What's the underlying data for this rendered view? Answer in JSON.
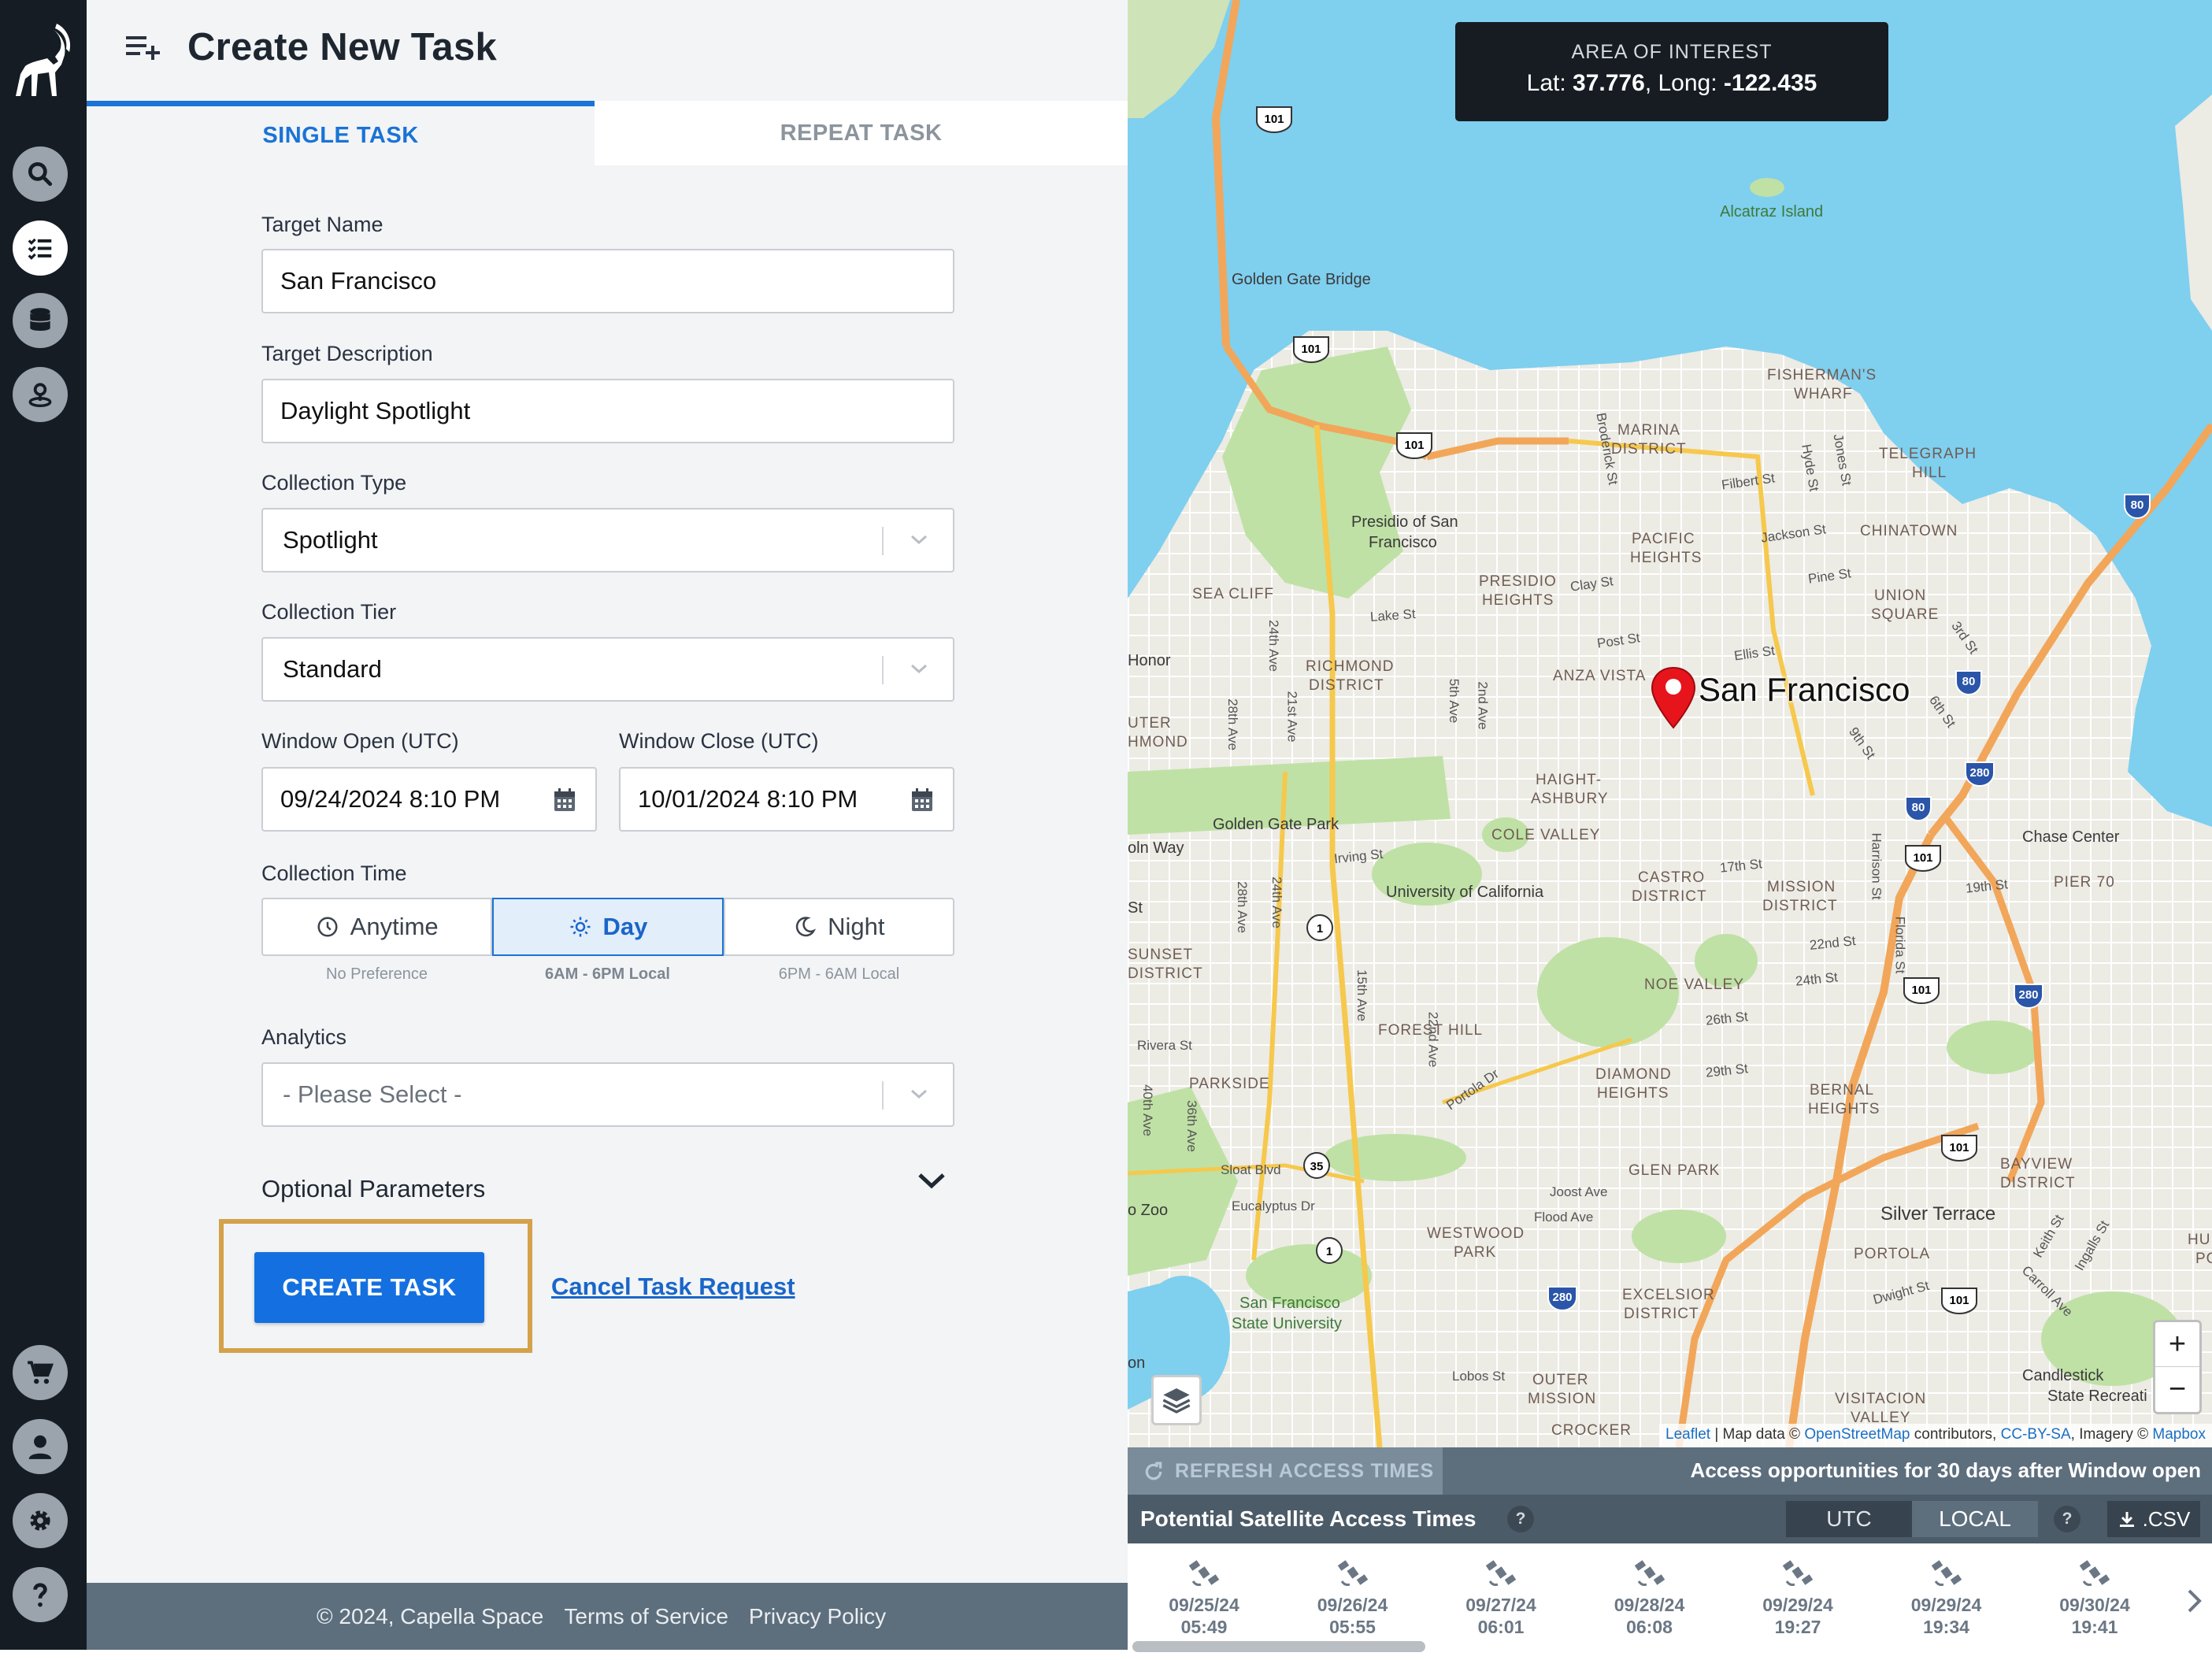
{
  "header": {
    "title": "Create New Task"
  },
  "tabs": {
    "single": "SINGLE TASK",
    "repeat": "REPEAT TASK"
  },
  "form": {
    "target_name_label": "Target Name",
    "target_name_value": "San Francisco",
    "target_desc_label": "Target Description",
    "target_desc_value": "Daylight Spotlight",
    "collection_type_label": "Collection Type",
    "collection_type_value": "Spotlight",
    "collection_tier_label": "Collection Tier",
    "collection_tier_value": "Standard",
    "window_open_label": "Window Open (UTC)",
    "window_open_value": "09/24/2024 8:10 PM",
    "window_close_label": "Window Close (UTC)",
    "window_close_value": "10/01/2024 8:10 PM",
    "collection_time_label": "Collection Time",
    "collection_time": [
      {
        "label": "Anytime",
        "sub": "No Preference"
      },
      {
        "label": "Day",
        "sub": "6AM - 6PM Local",
        "selected": true
      },
      {
        "label": "Night",
        "sub": "6PM - 6AM Local"
      }
    ],
    "analytics_label": "Analytics",
    "analytics_placeholder": "- Please Select -",
    "optional_params": "Optional Parameters",
    "create_button": "CREATE TASK",
    "cancel_link": "Cancel Task Request"
  },
  "footer": {
    "copyright": "© 2024, Capella Space",
    "terms": "Terms of Service",
    "privacy": "Privacy Policy"
  },
  "map": {
    "aoi_title": "AREA OF INTEREST",
    "lat_label": "Lat:",
    "lat_value": "37.776",
    "long_label": "Long:",
    "long_value": "-122.435",
    "pin_label": "San Francisco",
    "zoom_in": "+",
    "zoom_out": "−",
    "attribution": {
      "leaflet": "Leaflet",
      "sep": " | Map data © ",
      "osm": "OpenStreetMap",
      "contrib": " contributors, ",
      "license": "CC-BY-SA",
      "imagery": ", Imagery © ",
      "mapbox": "Mapbox"
    },
    "labels": {
      "alcatraz": "Alcatraz Island",
      "golden_gate_bridge": "Golden Gate Bridge",
      "fishermans_wharf_1": "FISHERMAN'S",
      "fishermans_wharf_2": "WHARF",
      "marina_1": "MARINA",
      "marina_2": "DISTRICT",
      "telegraph_1": "TELEGRAPH",
      "telegraph_2": "HILL",
      "presidio_1": "Presidio of San",
      "presidio_2": "Francisco",
      "pacific_1": "PACIFIC",
      "pacific_2": "HEIGHTS",
      "chinatown": "CHINATOWN",
      "presidio_heights_1": "PRESIDIO",
      "presidio_heights_2": "HEIGHTS",
      "sea_cliff": "SEA CLIFF",
      "union_square_1": "UNION",
      "union_square_2": "SQUARE",
      "richmond_1": "RICHMOND",
      "richmond_2": "DISTRICT",
      "anza_vista": "ANZA VISTA",
      "outer_richmond_1": "UTER",
      "outer_richmond_2": "HMOND",
      "haight_1": "HAIGHT-",
      "haight_2": "ASHBURY",
      "golden_gate_park": "Golden Gate Park",
      "cole_valley": "COLE VALLEY",
      "chase_center": "Chase Center",
      "ucsf": "University of California",
      "castro_1": "CASTRO",
      "castro_2": "DISTRICT",
      "mission_1": "MISSION",
      "mission_2": "DISTRICT",
      "pier_70": "PIER 70",
      "sunset_1": "SUNSET",
      "sunset_2": "DISTRICT",
      "noe_valley": "NOE VALLEY",
      "forest_hill": "FOREST HILL",
      "parkside": "PARKSIDE",
      "diamond_1": "DIAMOND",
      "diamond_2": "HEIGHTS",
      "bernal_1": "BERNAL",
      "bernal_2": "HEIGHTS",
      "glen_park": "GLEN PARK",
      "bayview_1": "BAYVIEW",
      "bayview_2": "DISTRICT",
      "zoo": "o Zoo",
      "silver_terrace": "Silver Terrace",
      "westwood_1": "WESTWOOD",
      "westwood_2": "PARK",
      "portola": "PORTOLA",
      "sfsu_1": "San Francisco",
      "sfsu_2": "State University",
      "excelsior_1": "EXCELSIOR",
      "excelsior_2": "DISTRICT",
      "outer_mission_1": "OUTER",
      "outer_mission_2": "MISSION",
      "visitacion_1": "VISITACION",
      "visitacion_2": "VALLEY",
      "candlestick_1": "Candlestick",
      "candlestick_2": "State Recreati",
      "hunters_1": "HUNT",
      "hunters_2": "POI",
      "crocker": "CROCKER",
      "on": "on",
      "honor": "Honor",
      "lincoln_way": "oln Way",
      "lincoln_st": "St"
    },
    "streets": [
      "Broderick St",
      "Hyde St",
      "Jones St",
      "Filbert St",
      "Jackson St",
      "Pine St",
      "Clay St",
      "Lake St",
      "Post St",
      "Ellis St",
      "24th Ave",
      "28th Ave",
      "21st Ave",
      "5th Ave",
      "2nd Ave",
      "9th St",
      "6th St",
      "3rd St",
      "Irving St",
      "17th St",
      "19th St",
      "Harrison St",
      "22nd St",
      "24th St",
      "26th St",
      "Florida St",
      "28th Ave",
      "24th Ave",
      "15th Ave",
      "22nd Ave",
      "Rivera St",
      "40th Ave",
      "36th Ave",
      "Portola Dr",
      "29th St",
      "Sloat Blvd",
      "Eucalyptus Dr",
      "Joost Ave",
      "Flood Ave",
      "Dwight St",
      "Keith St",
      "Ingalls St",
      "Carroll Ave",
      "Lobos St"
    ],
    "shields": [
      "101",
      "101",
      "101",
      "101",
      "80",
      "80",
      "280",
      "80",
      "101",
      "101",
      "280",
      "101",
      "101",
      "280",
      "1",
      "1",
      "35"
    ]
  },
  "access": {
    "refresh": "REFRESH ACCESS TIMES",
    "note": "Access opportunities for 30 days after Window open",
    "title": "Potential Satellite Access Times",
    "help": "?",
    "utc": "UTC",
    "local": "LOCAL",
    "csv": ".CSV",
    "times": [
      {
        "date": "09/25/24",
        "time": "05:49"
      },
      {
        "date": "09/26/24",
        "time": "05:55"
      },
      {
        "date": "09/27/24",
        "time": "06:01"
      },
      {
        "date": "09/28/24",
        "time": "06:08"
      },
      {
        "date": "09/29/24",
        "time": "19:27"
      },
      {
        "date": "09/29/24",
        "time": "19:34"
      },
      {
        "date": "09/30/24",
        "time": "19:41"
      }
    ]
  },
  "colors": {
    "primary": "#1470e0",
    "sidebar": "#151c23",
    "footer": "#5d6e7d",
    "highlight": "#d4a24a",
    "water": "#7fcfef",
    "park": "#bfe1a5"
  }
}
